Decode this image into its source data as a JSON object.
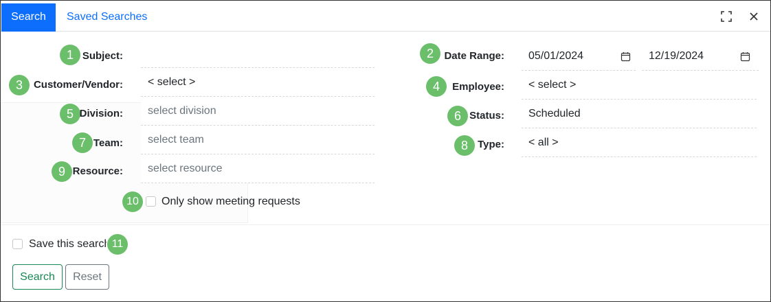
{
  "tabs": {
    "search": "Search",
    "saved": "Saved Searches"
  },
  "icons": {
    "expand": "expand-icon",
    "close": "close-icon",
    "calendar": "calendar-icon"
  },
  "colors": {
    "accent": "#0d6efd",
    "badge": "#6bbf6b",
    "search_btn": "#198754"
  },
  "badges": [
    "1",
    "2",
    "3",
    "4",
    "5",
    "6",
    "7",
    "8",
    "9",
    "10",
    "11"
  ],
  "fields": {
    "subject": {
      "label": "Subject:",
      "value": ""
    },
    "customer_vendor": {
      "label": "Customer/Vendor:",
      "value": "< select >"
    },
    "division": {
      "label": "Division:",
      "placeholder": "select division"
    },
    "team": {
      "label": "Team:",
      "placeholder": "select team"
    },
    "resource": {
      "label": "Resource:",
      "placeholder": "select resource"
    },
    "date_range": {
      "label": "Date Range:",
      "start": "05/01/2024",
      "end": "12/19/2024"
    },
    "employee": {
      "label": "Employee:",
      "value": "< select >"
    },
    "status": {
      "label": "Status:",
      "value": "Scheduled"
    },
    "type": {
      "label": "Type:",
      "value": "< all >"
    }
  },
  "meeting_requests": {
    "label": "Only show meeting requests",
    "checked": false
  },
  "save_search": {
    "label": "Save this search",
    "checked": false
  },
  "buttons": {
    "search": "Search",
    "reset": "Reset"
  }
}
